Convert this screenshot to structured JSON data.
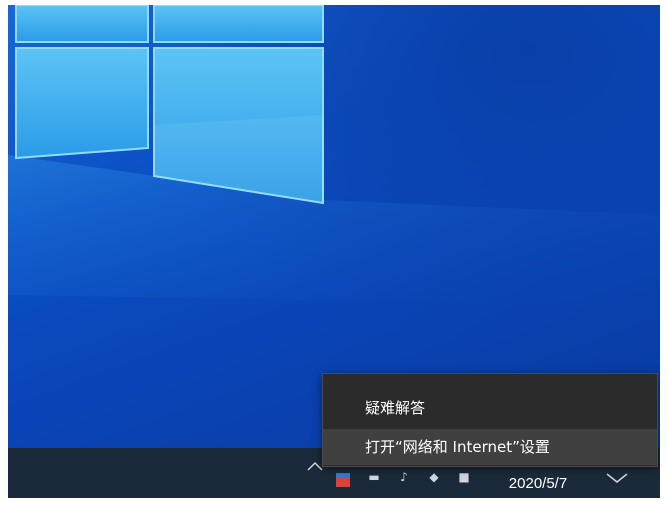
{
  "context_menu": {
    "items": [
      {
        "label": "疑难解答"
      },
      {
        "label": "打开“网络和 Internet”设置"
      }
    ]
  },
  "taskbar": {
    "tray_icons": [
      "chevron-up-icon",
      "app-tray-icon",
      "network-icon",
      "volume-icon",
      "ime-icon"
    ],
    "clock": {
      "date": "2020/5/7"
    }
  },
  "colors": {
    "menu_background": "#2b2b2b",
    "menu_hover": "#404040",
    "taskbar": "#1b2a3a",
    "wallpaper_blue": "#0b4fc4"
  }
}
